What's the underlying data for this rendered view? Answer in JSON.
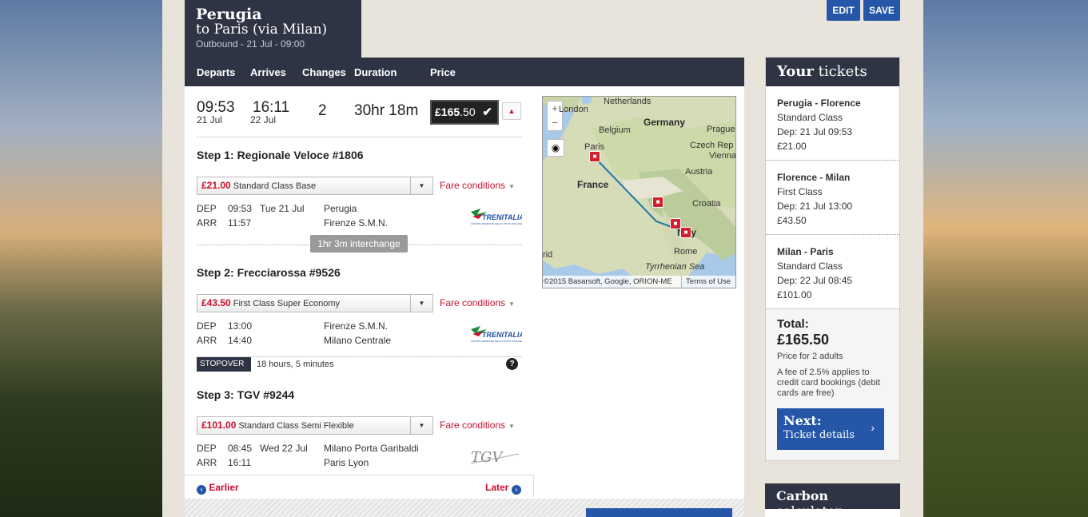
{
  "journey": {
    "origin": "Perugia",
    "destination_line": "to Paris (via Milan)",
    "outbound_line": "Outbound - 21 Jul - 09:00"
  },
  "actions": {
    "edit_label": "EDIT",
    "save_label": "SAVE"
  },
  "table_headers": [
    "Departs",
    "Arrives",
    "Changes",
    "Duration",
    "Price"
  ],
  "summary": {
    "depart_time": "09:53",
    "depart_date": "21 Jul",
    "arrive_time": "16:11",
    "arrive_date": "22 Jul",
    "changes": "2",
    "duration": "30hr 18m",
    "price_pounds": "£165",
    "price_pence": ".50"
  },
  "steps": [
    {
      "title": "Step 1: Regionale Veloce #1806",
      "fare_price": "£21.00",
      "fare_class": "Standard Class Base",
      "fare_conditions": "Fare conditions",
      "dep_label": "DEP",
      "dep_time": "09:53",
      "dep_date": "Tue 21 Jul",
      "dep_station": "Perugia",
      "arr_label": "ARR",
      "arr_time": "11:57",
      "arr_station": "Firenze S.M.N.",
      "operator": "TRENITALIA",
      "operator_icon": "trenitalia-logo"
    },
    {
      "title": "Step 2: Frecciarossa #9526",
      "fare_price": "£43.50",
      "fare_class": "First Class Super Economy",
      "fare_conditions": "Fare conditions",
      "dep_label": "DEP",
      "dep_time": "13:00",
      "dep_station": "Firenze S.M.N.",
      "arr_label": "ARR",
      "arr_time": "14:40",
      "arr_station": "Milano Centrale",
      "operator": "TRENITALIA",
      "operator_icon": "trenitalia-logo"
    },
    {
      "title": "Step 3: TGV #9244",
      "fare_price": "£101.00",
      "fare_class": "Standard Class Semi Flexible",
      "fare_conditions": "Fare conditions",
      "dep_label": "DEP",
      "dep_time": "08:45",
      "dep_date": "Wed 22 Jul",
      "dep_station": "Milano Porta Garibaldi",
      "arr_label": "ARR",
      "arr_time": "16:11",
      "arr_station": "Paris Lyon",
      "operator": "TGV",
      "operator_icon": "tgv-logo"
    }
  ],
  "interchange": "1hr 3m interchange",
  "stopover": {
    "tag": "STOPOVER",
    "text": "18 hours, 5 minutes",
    "help": "?"
  },
  "pager": {
    "earlier": "Earlier",
    "later": "Later"
  },
  "map": {
    "labels": {
      "netherlands": "Netherlands",
      "london": "London",
      "belgium": "Belgium",
      "germany": "Germany",
      "prague": "Prague",
      "paris": "Paris",
      "czech": "Czech Rep",
      "vienna": "Vienna",
      "austria": "Austria",
      "france": "France",
      "croatia": "Croatia",
      "italy": "Italy",
      "rome": "Rome",
      "tyrrhenian": "Tyrrhenian Sea",
      "madrid": "rid"
    },
    "zoom_in": "+",
    "zoom_out": "−",
    "attribution": "©2015 Basarsoft, Google, ORION-ME",
    "terms": "Terms of Use"
  },
  "tickets": {
    "title_bold": "Your",
    "title_rest": "tickets",
    "items": [
      {
        "route": "Perugia - Florence",
        "class": "Standard Class",
        "dep": "Dep: 21 Jul 09:53",
        "price": "£21.00"
      },
      {
        "route": "Florence - Milan",
        "class": "First Class",
        "dep": "Dep: 21 Jul 13:00",
        "price": "£43.50"
      },
      {
        "route": "Milan - Paris",
        "class": "Standard Class",
        "dep": "Dep: 22 Jul 08:45",
        "price": "£101.00"
      }
    ],
    "total_label": "Total:",
    "total_price": "£165.50",
    "passengers": "Price for 2 adults",
    "fee_note": "A fee of 2.5% applies to credit card bookings (debit cards are free)",
    "next_label": "Next:",
    "next_sub": "Ticket details"
  },
  "carbon": {
    "title_bold": "Carbon",
    "title_rest": "calculator"
  },
  "colors": {
    "navy": "#2f3444",
    "accent_blue": "#2556a7",
    "fare_red": "#c8102e"
  }
}
